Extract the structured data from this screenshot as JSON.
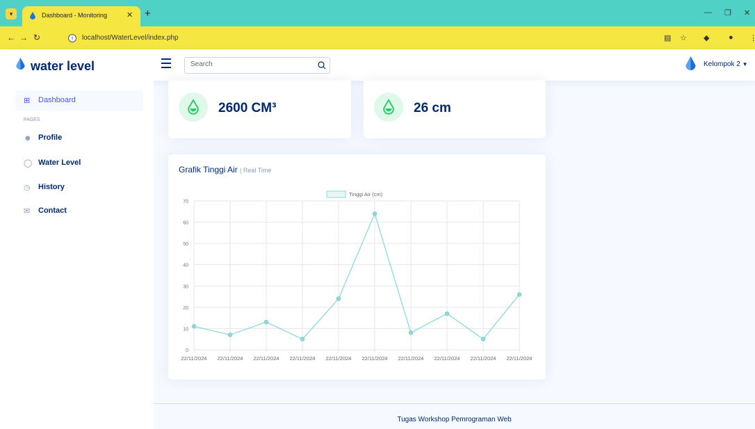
{
  "browser": {
    "tab_title": "Dashboard - Monitoring",
    "url": "localhost/WaterLevel/index.php",
    "accent": "#4fd1c5",
    "highlight": "#f5e642"
  },
  "header": {
    "logo_text": "water level",
    "search_placeholder": "Search",
    "user_name": "Kelompok 2"
  },
  "sidebar": {
    "items": [
      {
        "label": "Dashboard",
        "icon": "grid-icon",
        "active": true
      },
      {
        "label": "Profile",
        "icon": "person-icon",
        "active": false
      },
      {
        "label": "Water Level",
        "icon": "water-drop-icon",
        "active": false
      },
      {
        "label": "History",
        "icon": "clock-icon",
        "active": false
      },
      {
        "label": "Contact",
        "icon": "envelope-icon",
        "active": false
      }
    ],
    "pages_heading": "PAGES"
  },
  "cards": [
    {
      "value": "2600 CM³",
      "icon": "water-drop-icon"
    },
    {
      "value": "26 cm",
      "icon": "water-drop-icon"
    }
  ],
  "chart": {
    "title": "Grafik Tinggi Air",
    "subtitle": "| Real Time"
  },
  "chart_data": {
    "type": "line",
    "legend": "Tinggi Air (cm)",
    "legend_position": "top",
    "categories": [
      "22/11/2024",
      "22/11/2024",
      "22/11/2024",
      "22/11/2024",
      "22/11/2024",
      "22/11/2024",
      "22/11/2024",
      "22/11/2024",
      "22/11/2024",
      "22/11/2024"
    ],
    "series": [
      {
        "name": "Tinggi Air (cm)",
        "values": [
          11,
          7,
          13,
          5,
          24,
          64,
          8,
          17,
          5,
          26
        ],
        "color": "#8fd9d9"
      }
    ],
    "ylim": [
      0,
      70
    ],
    "yticks": [
      0,
      10,
      20,
      30,
      40,
      50,
      60,
      70
    ],
    "grid": true
  },
  "footer": {
    "text": "Tugas Workshop Pemrograman Web"
  }
}
